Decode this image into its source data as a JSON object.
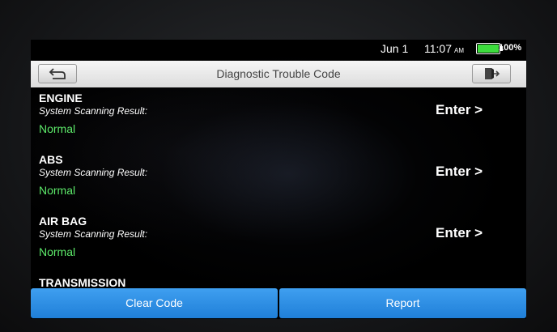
{
  "status_bar": {
    "date": "Jun 1",
    "time": "11:07",
    "ampm": "AM",
    "battery_percent": "100%",
    "battery_level": 1.0,
    "battery_color": "#3ddc3d"
  },
  "title_bar": {
    "title": "Diagnostic Trouble Code",
    "back_icon": "back-arrow-icon",
    "exit_icon": "exit-icon"
  },
  "systems": [
    {
      "name": "ENGINE",
      "result_label": "System Scanning Result:",
      "status": "Normal",
      "action": "Enter >"
    },
    {
      "name": "ABS",
      "result_label": "System Scanning Result:",
      "status": "Normal",
      "action": "Enter >"
    },
    {
      "name": "AIR BAG",
      "result_label": "System Scanning Result:",
      "status": "Normal",
      "action": "Enter >"
    },
    {
      "name": "TRANSMISSION"
    }
  ],
  "bottom_bar": {
    "clear_code": "Clear Code",
    "report": "Report"
  },
  "colors": {
    "normal_status": "#5dea6a",
    "button_blue": "#2b8fe6"
  }
}
